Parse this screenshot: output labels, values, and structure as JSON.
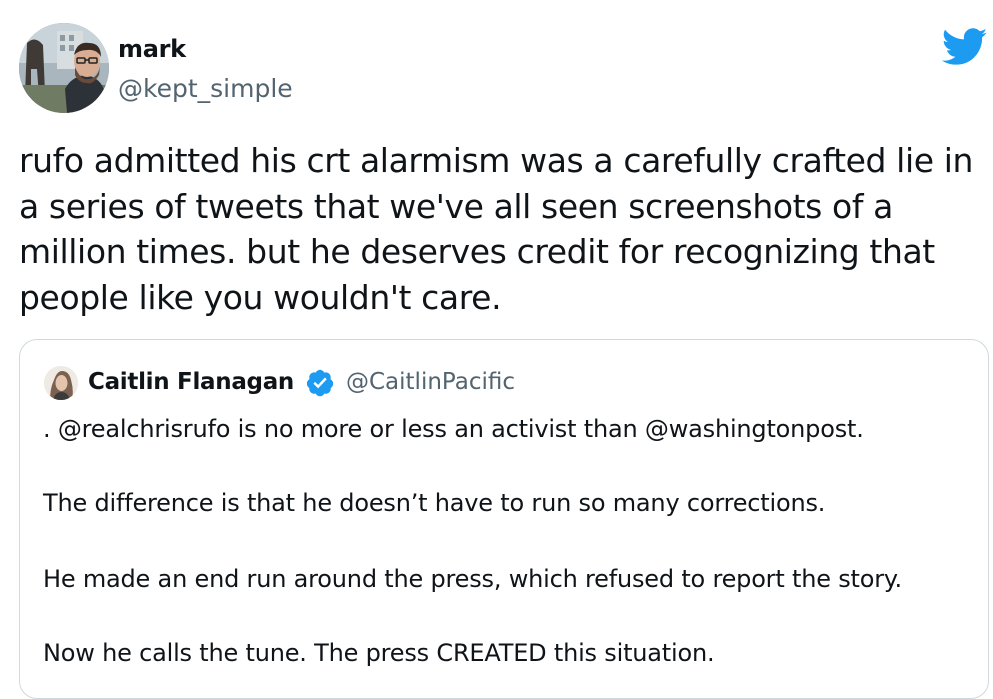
{
  "tweet": {
    "author": {
      "name": "mark",
      "handle": "@kept_simple"
    },
    "brand_icon": "twitter-bird-icon",
    "text": "rufo admitted his crt alarmism was a carefully crafted lie in a series of tweets that we've all seen screenshots of a million times. but he deserves credit for recognizing that people like you wouldn't care."
  },
  "quoted_tweet": {
    "author": {
      "name": "Caitlin Flanagan",
      "handle": "@CaitlinPacific",
      "verified": true
    },
    "lines": [
      ". @realchrisrufo is no more or less an activist than @washingtonpost.",
      "The difference is that he doesn’t have to run so many corrections.",
      "He made an end run around the press, which refused to report the story.",
      "Now he calls the tune. The press CREATED this situation."
    ]
  },
  "colors": {
    "text": "#0f1419",
    "secondary_text": "#536471",
    "brand_blue": "#1d9bf0",
    "border": "#cfd9de"
  }
}
